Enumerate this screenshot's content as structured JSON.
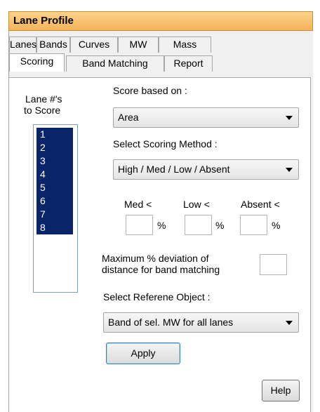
{
  "window": {
    "title": "Lane Profile"
  },
  "tabs": {
    "row1": [
      "Lanes",
      "Bands",
      "Curves",
      "MW",
      "Mass"
    ],
    "row2": [
      "Scoring",
      "Band Matching",
      "Report"
    ],
    "active": "Scoring"
  },
  "scoring": {
    "lanes_label_line1": "Lane #'s",
    "lanes_label_line2": "to Score",
    "lanes": [
      "1",
      "2",
      "3",
      "4",
      "5",
      "6",
      "7",
      "8"
    ],
    "score_based_on_label": "Score based on :",
    "score_based_on_value": "Area",
    "scoring_method_label": "Select Scoring Method :",
    "scoring_method_value": "High / Med / Low / Absent",
    "med_label": "Med <",
    "low_label": "Low <",
    "absent_label": "Absent <",
    "med_value": "",
    "low_value": "",
    "absent_value": "",
    "percent_symbol": "%",
    "deviation_label_line1": "Maximum % deviation of",
    "deviation_label_line2": "distance for band matching",
    "deviation_value": "",
    "reference_label": "Select Referene Object :",
    "reference_value": "Band of sel. MW for all lanes",
    "apply_label": "Apply",
    "help_label": "Help"
  }
}
